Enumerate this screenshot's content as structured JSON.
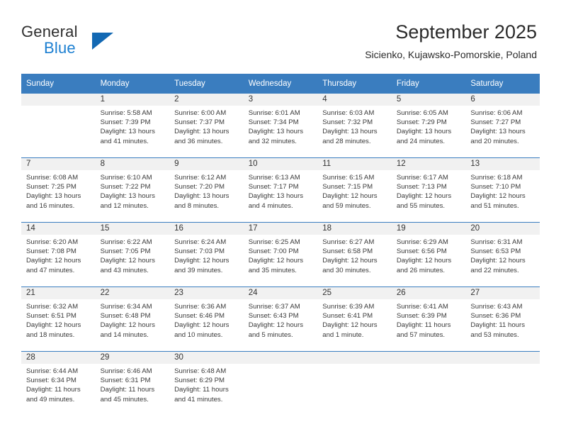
{
  "brand": {
    "word_one": "General",
    "word_two": "Blue",
    "logo_icon": "triangle-logo-icon",
    "accent_color": "#1268b3"
  },
  "header": {
    "title": "September 2025",
    "subtitle": "Sicienko, Kujawsko-Pomorskie, Poland"
  },
  "theme": {
    "header_blue": "#3a7dbf",
    "number_band_gray": "#f1f1f1",
    "text_color": "#3a3a3a"
  },
  "weekday_headers": [
    "Sunday",
    "Monday",
    "Tuesday",
    "Wednesday",
    "Thursday",
    "Friday",
    "Saturday"
  ],
  "weeks": [
    {
      "days": [
        {
          "date": "",
          "sunrise": "",
          "sunset": "",
          "daylight_a": "",
          "daylight_b": "",
          "blank": true
        },
        {
          "date": "1",
          "sunrise": "Sunrise: 5:58 AM",
          "sunset": "Sunset: 7:39 PM",
          "daylight_a": "Daylight: 13 hours",
          "daylight_b": "and 41 minutes."
        },
        {
          "date": "2",
          "sunrise": "Sunrise: 6:00 AM",
          "sunset": "Sunset: 7:37 PM",
          "daylight_a": "Daylight: 13 hours",
          "daylight_b": "and 36 minutes."
        },
        {
          "date": "3",
          "sunrise": "Sunrise: 6:01 AM",
          "sunset": "Sunset: 7:34 PM",
          "daylight_a": "Daylight: 13 hours",
          "daylight_b": "and 32 minutes."
        },
        {
          "date": "4",
          "sunrise": "Sunrise: 6:03 AM",
          "sunset": "Sunset: 7:32 PM",
          "daylight_a": "Daylight: 13 hours",
          "daylight_b": "and 28 minutes."
        },
        {
          "date": "5",
          "sunrise": "Sunrise: 6:05 AM",
          "sunset": "Sunset: 7:29 PM",
          "daylight_a": "Daylight: 13 hours",
          "daylight_b": "and 24 minutes."
        },
        {
          "date": "6",
          "sunrise": "Sunrise: 6:06 AM",
          "sunset": "Sunset: 7:27 PM",
          "daylight_a": "Daylight: 13 hours",
          "daylight_b": "and 20 minutes."
        }
      ]
    },
    {
      "days": [
        {
          "date": "7",
          "sunrise": "Sunrise: 6:08 AM",
          "sunset": "Sunset: 7:25 PM",
          "daylight_a": "Daylight: 13 hours",
          "daylight_b": "and 16 minutes."
        },
        {
          "date": "8",
          "sunrise": "Sunrise: 6:10 AM",
          "sunset": "Sunset: 7:22 PM",
          "daylight_a": "Daylight: 13 hours",
          "daylight_b": "and 12 minutes."
        },
        {
          "date": "9",
          "sunrise": "Sunrise: 6:12 AM",
          "sunset": "Sunset: 7:20 PM",
          "daylight_a": "Daylight: 13 hours",
          "daylight_b": "and 8 minutes."
        },
        {
          "date": "10",
          "sunrise": "Sunrise: 6:13 AM",
          "sunset": "Sunset: 7:17 PM",
          "daylight_a": "Daylight: 13 hours",
          "daylight_b": "and 4 minutes."
        },
        {
          "date": "11",
          "sunrise": "Sunrise: 6:15 AM",
          "sunset": "Sunset: 7:15 PM",
          "daylight_a": "Daylight: 12 hours",
          "daylight_b": "and 59 minutes."
        },
        {
          "date": "12",
          "sunrise": "Sunrise: 6:17 AM",
          "sunset": "Sunset: 7:13 PM",
          "daylight_a": "Daylight: 12 hours",
          "daylight_b": "and 55 minutes."
        },
        {
          "date": "13",
          "sunrise": "Sunrise: 6:18 AM",
          "sunset": "Sunset: 7:10 PM",
          "daylight_a": "Daylight: 12 hours",
          "daylight_b": "and 51 minutes."
        }
      ]
    },
    {
      "days": [
        {
          "date": "14",
          "sunrise": "Sunrise: 6:20 AM",
          "sunset": "Sunset: 7:08 PM",
          "daylight_a": "Daylight: 12 hours",
          "daylight_b": "and 47 minutes."
        },
        {
          "date": "15",
          "sunrise": "Sunrise: 6:22 AM",
          "sunset": "Sunset: 7:05 PM",
          "daylight_a": "Daylight: 12 hours",
          "daylight_b": "and 43 minutes."
        },
        {
          "date": "16",
          "sunrise": "Sunrise: 6:24 AM",
          "sunset": "Sunset: 7:03 PM",
          "daylight_a": "Daylight: 12 hours",
          "daylight_b": "and 39 minutes."
        },
        {
          "date": "17",
          "sunrise": "Sunrise: 6:25 AM",
          "sunset": "Sunset: 7:00 PM",
          "daylight_a": "Daylight: 12 hours",
          "daylight_b": "and 35 minutes."
        },
        {
          "date": "18",
          "sunrise": "Sunrise: 6:27 AM",
          "sunset": "Sunset: 6:58 PM",
          "daylight_a": "Daylight: 12 hours",
          "daylight_b": "and 30 minutes."
        },
        {
          "date": "19",
          "sunrise": "Sunrise: 6:29 AM",
          "sunset": "Sunset: 6:56 PM",
          "daylight_a": "Daylight: 12 hours",
          "daylight_b": "and 26 minutes."
        },
        {
          "date": "20",
          "sunrise": "Sunrise: 6:31 AM",
          "sunset": "Sunset: 6:53 PM",
          "daylight_a": "Daylight: 12 hours",
          "daylight_b": "and 22 minutes."
        }
      ]
    },
    {
      "days": [
        {
          "date": "21",
          "sunrise": "Sunrise: 6:32 AM",
          "sunset": "Sunset: 6:51 PM",
          "daylight_a": "Daylight: 12 hours",
          "daylight_b": "and 18 minutes."
        },
        {
          "date": "22",
          "sunrise": "Sunrise: 6:34 AM",
          "sunset": "Sunset: 6:48 PM",
          "daylight_a": "Daylight: 12 hours",
          "daylight_b": "and 14 minutes."
        },
        {
          "date": "23",
          "sunrise": "Sunrise: 6:36 AM",
          "sunset": "Sunset: 6:46 PM",
          "daylight_a": "Daylight: 12 hours",
          "daylight_b": "and 10 minutes."
        },
        {
          "date": "24",
          "sunrise": "Sunrise: 6:37 AM",
          "sunset": "Sunset: 6:43 PM",
          "daylight_a": "Daylight: 12 hours",
          "daylight_b": "and 5 minutes."
        },
        {
          "date": "25",
          "sunrise": "Sunrise: 6:39 AM",
          "sunset": "Sunset: 6:41 PM",
          "daylight_a": "Daylight: 12 hours",
          "daylight_b": "and 1 minute."
        },
        {
          "date": "26",
          "sunrise": "Sunrise: 6:41 AM",
          "sunset": "Sunset: 6:39 PM",
          "daylight_a": "Daylight: 11 hours",
          "daylight_b": "and 57 minutes."
        },
        {
          "date": "27",
          "sunrise": "Sunrise: 6:43 AM",
          "sunset": "Sunset: 6:36 PM",
          "daylight_a": "Daylight: 11 hours",
          "daylight_b": "and 53 minutes."
        }
      ]
    },
    {
      "days": [
        {
          "date": "28",
          "sunrise": "Sunrise: 6:44 AM",
          "sunset": "Sunset: 6:34 PM",
          "daylight_a": "Daylight: 11 hours",
          "daylight_b": "and 49 minutes."
        },
        {
          "date": "29",
          "sunrise": "Sunrise: 6:46 AM",
          "sunset": "Sunset: 6:31 PM",
          "daylight_a": "Daylight: 11 hours",
          "daylight_b": "and 45 minutes."
        },
        {
          "date": "30",
          "sunrise": "Sunrise: 6:48 AM",
          "sunset": "Sunset: 6:29 PM",
          "daylight_a": "Daylight: 11 hours",
          "daylight_b": "and 41 minutes."
        },
        {
          "date": "",
          "sunrise": "",
          "sunset": "",
          "daylight_a": "",
          "daylight_b": "",
          "blank": true
        },
        {
          "date": "",
          "sunrise": "",
          "sunset": "",
          "daylight_a": "",
          "daylight_b": "",
          "blank": true
        },
        {
          "date": "",
          "sunrise": "",
          "sunset": "",
          "daylight_a": "",
          "daylight_b": "",
          "blank": true
        },
        {
          "date": "",
          "sunrise": "",
          "sunset": "",
          "daylight_a": "",
          "daylight_b": "",
          "blank": true
        }
      ]
    }
  ]
}
